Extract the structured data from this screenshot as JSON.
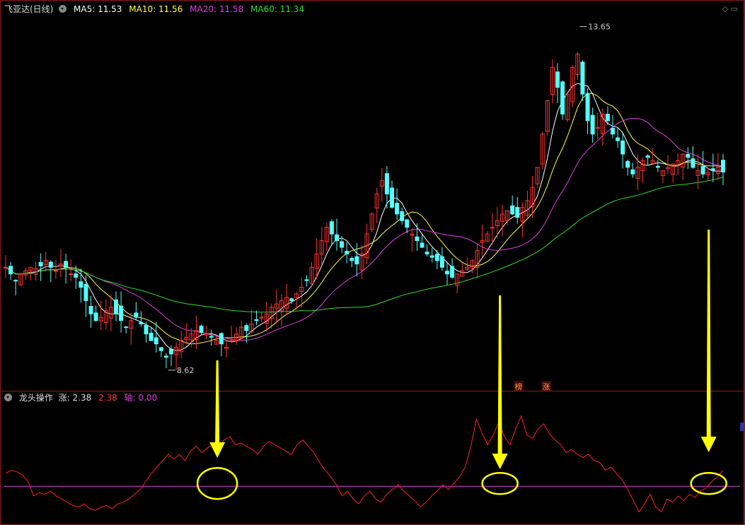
{
  "main_header": {
    "title": "飞亚达(日线)",
    "ma": [
      {
        "label": "MA5: 11.53",
        "color": "#ffffff"
      },
      {
        "label": "MA10: 11.56",
        "color": "#ffff4d"
      },
      {
        "label": "MA20: 11.58",
        "color": "#e040e0"
      },
      {
        "label": "MA60: 11.34",
        "color": "#33dd33"
      }
    ]
  },
  "sub_header": {
    "title": "龙头操作",
    "zhang": "涨: 2.38",
    "zhang2": "2.38",
    "zhou": "轴: 0.00"
  },
  "colors": {
    "up": "#ff3333",
    "down": "#54ffff",
    "ma5": "#ffffff",
    "ma10": "#ffff4d",
    "ma20": "#e040e0",
    "ma60": "#33dd33",
    "indicator": "#ff2020",
    "axis_line": "#e040e0",
    "frame": "#8b1a1a",
    "arrow": "#ffff00"
  },
  "chart_data": [
    {
      "type": "candlestick",
      "title": "飞亚达(日线)",
      "ylim": [
        8.3,
        13.9
      ],
      "annotations": [
        {
          "text": "13.65",
          "value": 13.65,
          "kind": "high"
        },
        {
          "text": "8.62",
          "value": 8.62,
          "kind": "low"
        }
      ],
      "series": [
        {
          "name": "price",
          "close": [
            10.1,
            10.0,
            9.9,
            10.0,
            10.05,
            10.1,
            10.08,
            10.12,
            10.2,
            10.1,
            10.05,
            10.15,
            10.1,
            10.0,
            9.95,
            9.8,
            9.6,
            9.4,
            9.3,
            9.35,
            9.45,
            9.5,
            9.4,
            9.3,
            9.2,
            9.3,
            9.35,
            9.25,
            9.1,
            9.0,
            8.95,
            8.85,
            8.75,
            8.8,
            8.9,
            9.0,
            9.05,
            9.1,
            9.15,
            9.12,
            9.1,
            9.05,
            9.0,
            8.95,
            8.9,
            9.0,
            9.1,
            9.2,
            9.15,
            9.25,
            9.3,
            9.35,
            9.4,
            9.5,
            9.55,
            9.6,
            9.65,
            9.6,
            9.7,
            9.8,
            9.9,
            10.1,
            10.3,
            10.5,
            10.7,
            10.6,
            10.5,
            10.4,
            10.3,
            10.2,
            10.15,
            10.3,
            10.6,
            10.9,
            11.2,
            11.4,
            11.2,
            11.0,
            10.9,
            10.8,
            10.7,
            10.6,
            10.5,
            10.4,
            10.3,
            10.25,
            10.2,
            10.1,
            10.0,
            9.95,
            10.0,
            10.05,
            10.1,
            10.2,
            10.35,
            10.5,
            10.6,
            10.7,
            10.8,
            10.9,
            10.95,
            10.9,
            10.85,
            11.0,
            11.1,
            11.3,
            11.6,
            12.1,
            12.6,
            13.1,
            12.8,
            12.4,
            12.7,
            13.1,
            13.3,
            12.7,
            12.3,
            12.1,
            12.2,
            12.4,
            12.3,
            12.1,
            12.0,
            11.8,
            11.6,
            11.5,
            11.6,
            11.7,
            11.75,
            11.7,
            11.6,
            11.55,
            11.6,
            11.65,
            11.7,
            11.8,
            11.75,
            11.6,
            11.55,
            11.5,
            11.52,
            11.55,
            11.6,
            11.53
          ]
        }
      ]
    },
    {
      "type": "line",
      "title": "龙头操作",
      "series": [
        {
          "name": "涨",
          "values": [
            0.8,
            1.0,
            0.9,
            0.7,
            0.3,
            -0.6,
            -0.4,
            -0.5,
            -0.3,
            -0.6,
            -0.8,
            -1.0,
            -1.2,
            -1.3,
            -1.1,
            -1.4,
            -1.5,
            -1.3,
            -1.2,
            -1.4,
            -1.1,
            -1.0,
            -0.8,
            -0.5,
            -0.2,
            0.3,
            0.8,
            1.2,
            1.6,
            2.0,
            1.7,
            2.0,
            1.6,
            2.2,
            2.5,
            2.1,
            2.4,
            2.6,
            2.4,
            2.9,
            3.1,
            2.6,
            2.7,
            2.5,
            2.3,
            2.0,
            2.5,
            2.8,
            2.6,
            2.4,
            2.2,
            2.0,
            2.6,
            2.9,
            2.5,
            2.1,
            1.5,
            1.0,
            0.6,
            0.1,
            -0.6,
            -0.3,
            -0.8,
            -1.1,
            -0.6,
            -0.3,
            -0.8,
            -1.0,
            -0.5,
            -0.2,
            0.1,
            -0.3,
            -0.6,
            -0.9,
            -1.3,
            -1.0,
            -0.6,
            -0.3,
            0.1,
            -0.2,
            0.2,
            0.6,
            1.2,
            2.5,
            4.2,
            3.3,
            2.6,
            3.2,
            4.0,
            3.1,
            2.6,
            3.6,
            4.4,
            3.2,
            3.0,
            3.6,
            3.9,
            3.3,
            2.9,
            2.6,
            2.1,
            2.3,
            2.0,
            1.8,
            2.0,
            1.6,
            1.5,
            1.0,
            1.2,
            0.8,
            0.4,
            -0.2,
            -0.9,
            -1.6,
            -1.1,
            -0.5,
            -1.3,
            -1.6,
            -0.8,
            -1.0,
            -0.6,
            -0.9,
            -0.5,
            -0.7,
            -0.3,
            -0.1,
            0.3,
            0.6,
            1.0
          ]
        },
        {
          "name": "轴",
          "values": [
            0.0
          ]
        }
      ]
    }
  ]
}
